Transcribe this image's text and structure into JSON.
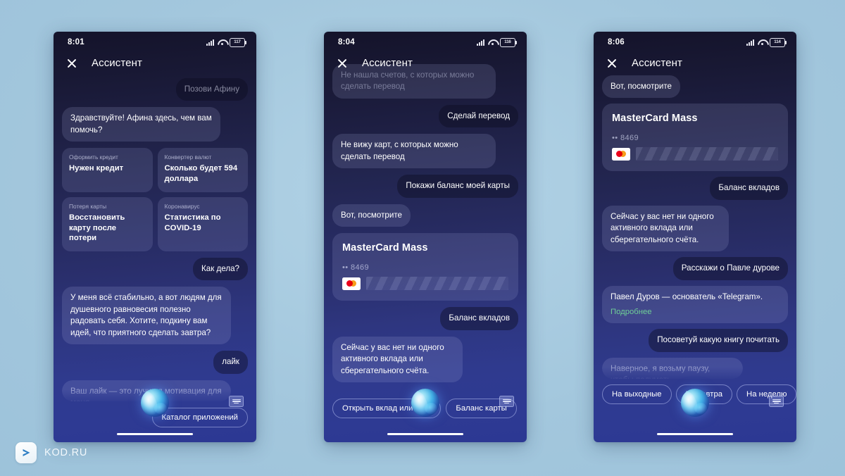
{
  "background_color": "#a3c7dd",
  "watermark": {
    "brand": "KOD.RU",
    "logo_icon": "play-arrow-icon"
  },
  "phones": [
    {
      "id": "phone-1",
      "status": {
        "time": "8:01",
        "battery_label": "117",
        "signal_icon": "signal-bars-icon",
        "wifi_icon": "wifi-icon",
        "battery_icon": "battery-icon"
      },
      "header": {
        "close_icon": "close-icon",
        "title": "Ассистент"
      },
      "messages": [
        {
          "kind": "out",
          "text": "Позови Афину",
          "faded": true
        },
        {
          "kind": "in",
          "text": "Здравствуйте! Афина здесь, чем вам помочь?"
        },
        {
          "kind": "suggestions",
          "items": [
            {
              "category": "Оформить кредит",
              "text": "Нужен кредит"
            },
            {
              "category": "Конвертер валют",
              "text": "Сколько будет 594 доллара"
            },
            {
              "category": "Потеря карты",
              "text": "Восстановить карту после потери"
            },
            {
              "category": "Коронавирус",
              "text": "Статистика по COVID-19"
            }
          ]
        },
        {
          "kind": "out",
          "text": "Как дела?"
        },
        {
          "kind": "in",
          "text": "У меня всё стабильно, а вот людям для душевного равновесия полезно радовать себя. Хотите, подкину вам идей, что приятного сделать завтра?"
        },
        {
          "kind": "out",
          "text": "лайк"
        },
        {
          "kind": "in",
          "text": "Ваш лайк — это лучшая мотивация для меня.",
          "faded": true,
          "cut": true
        },
        {
          "kind": "pills",
          "align": "end",
          "items": [
            "Каталог приложений"
          ]
        }
      ],
      "bottom": {
        "orb_icon": "assistant-orb-icon",
        "keyboard_icon": "keyboard-icon",
        "home_indicator": "home-indicator"
      }
    },
    {
      "id": "phone-2",
      "status": {
        "time": "8:04",
        "battery_label": "116",
        "signal_icon": "signal-bars-icon",
        "wifi_icon": "wifi-icon",
        "battery_icon": "battery-icon"
      },
      "header": {
        "close_icon": "close-icon",
        "title": "Ассистент"
      },
      "messages": [
        {
          "kind": "in",
          "text": "Не нашла счетов, с которых можно сделать перевод",
          "clipped": true
        },
        {
          "kind": "out",
          "text": "Сделай перевод"
        },
        {
          "kind": "in",
          "text": "Не вижу карт, с которых можно сделать перевод"
        },
        {
          "kind": "out",
          "text": "Покажи баланс моей карты"
        },
        {
          "kind": "in",
          "text": "Вот, посмотрите"
        },
        {
          "kind": "card",
          "name": "MasterCard Mass",
          "number": "•• 8469",
          "brand_icon": "mastercard-icon"
        },
        {
          "kind": "out",
          "text": "Баланс вкладов"
        },
        {
          "kind": "in",
          "text": "Сейчас у вас нет ни одного активного вклада или сберегательного счёта."
        },
        {
          "kind": "pills",
          "align": "start",
          "items": [
            "Открыть вклад или счёт",
            "Баланс карты"
          ]
        }
      ],
      "bottom": {
        "orb_icon": "assistant-orb-icon",
        "keyboard_icon": "keyboard-icon",
        "home_indicator": "home-indicator"
      }
    },
    {
      "id": "phone-3",
      "status": {
        "time": "8:06",
        "battery_label": "114",
        "signal_icon": "signal-bars-icon",
        "wifi_icon": "wifi-icon",
        "battery_icon": "battery-icon"
      },
      "header": {
        "close_icon": "close-icon",
        "title": "Ассистент"
      },
      "messages": [
        {
          "kind": "in",
          "text": "Вот, посмотрите"
        },
        {
          "kind": "card",
          "name": "MasterCard Mass",
          "number": "•• 8469",
          "brand_icon": "mastercard-icon"
        },
        {
          "kind": "out",
          "text": "Баланс вкладов"
        },
        {
          "kind": "in",
          "text": "Сейчас у вас нет ни одного активного вклада или сберегательного счёта."
        },
        {
          "kind": "out",
          "text": "Расскажи о Павле дурове"
        },
        {
          "kind": "in",
          "text": "Павел Дуров — основатель «Telegram».",
          "link": "Подробнее",
          "link_color": "#6fcf97"
        },
        {
          "kind": "out",
          "text": "Посоветуй какую книгу почитать"
        },
        {
          "kind": "in",
          "text": "Наверное, я возьму паузу, чтобы подумать",
          "cut": true
        },
        {
          "kind": "pills",
          "align": "start",
          "items": [
            "На выходные",
            "На завтра",
            "На неделю"
          ]
        }
      ],
      "bottom": {
        "orb_icon": "assistant-orb-icon",
        "keyboard_icon": "keyboard-icon",
        "home_indicator": "home-indicator"
      }
    }
  ]
}
